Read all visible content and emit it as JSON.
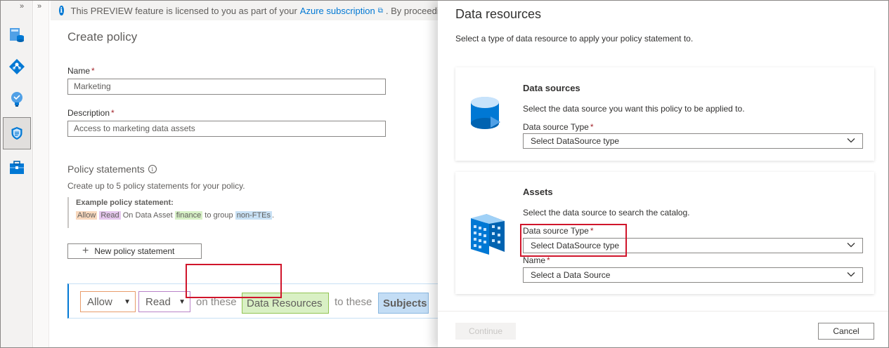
{
  "rail": {
    "expand_glyph": "»",
    "icons": [
      "data-catalog-icon",
      "data-map-icon",
      "insights-icon",
      "policy-shield-icon",
      "management-toolbox-icon"
    ]
  },
  "col2": {
    "expand_glyph": "»"
  },
  "infobar": {
    "text": "This PREVIEW feature is licensed to you as part of your",
    "link": "Azure subscription",
    "tail": ". By proceedin"
  },
  "policy": {
    "title": "Create policy",
    "name_label": "Name",
    "name_value": "Marketing",
    "description_label": "Description",
    "description_value": "Access to marketing data assets",
    "required_mark": "*",
    "statements_title": "Policy statements",
    "statements_sub": "Create up to 5 policy statements for your policy.",
    "example_heading": "Example policy statement:",
    "example": {
      "allow": "Allow",
      "read": "Read",
      "on_data_asset": "On Data Asset",
      "finance": "finance",
      "to_group": "to group",
      "non_ftes": "non-FTEs",
      "period": "."
    },
    "new_statement_label": "New policy statement",
    "builder": {
      "effect": "Allow",
      "action": "Read",
      "on_these": "on these",
      "data_resources": "Data Resources",
      "to_these": "to these",
      "subjects": "Subjects"
    }
  },
  "panel": {
    "title": "Data resources",
    "subtitle": "Select a type of data resource to apply your policy statement to.",
    "data_sources": {
      "title": "Data sources",
      "description": "Select the data source you want this policy to be applied to.",
      "type_label": "Data source Type",
      "type_placeholder": "Select DataSource type"
    },
    "assets": {
      "title": "Assets",
      "description": "Select the data source to search the catalog.",
      "type_label": "Data source Type",
      "type_placeholder": "Select DataSource type",
      "name_label": "Name",
      "name_placeholder": "Select a Data Source"
    },
    "continue_label": "Continue",
    "cancel_label": "Cancel"
  },
  "colors": {
    "accent": "#0078d4",
    "highlight_box": "#d0152b",
    "tag_allow": "#f8d8bd",
    "tag_read": "#e5c7ee",
    "tag_finance": "#d7f1c6",
    "tag_group": "#c8e1f5"
  }
}
